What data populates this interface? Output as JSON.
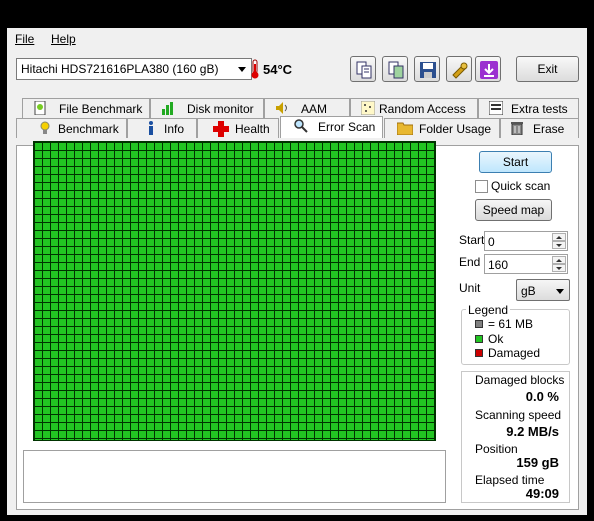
{
  "menu": {
    "file": "File",
    "help": "Help"
  },
  "toolbar": {
    "drive": "Hitachi HDS721616PLA380 (160 gB)",
    "temperature": "54°C",
    "exit_label": "Exit"
  },
  "tabs_top": [
    {
      "label": "File Benchmark"
    },
    {
      "label": "Disk monitor"
    },
    {
      "label": "AAM"
    },
    {
      "label": "Random Access"
    },
    {
      "label": "Extra tests"
    }
  ],
  "tabs_bottom": [
    {
      "label": "Benchmark"
    },
    {
      "label": "Info"
    },
    {
      "label": "Health"
    },
    {
      "label": "Error Scan"
    },
    {
      "label": "Folder Usage"
    },
    {
      "label": "Erase"
    }
  ],
  "scan": {
    "start_button": "Start",
    "quick_scan_label": "Quick scan",
    "quick_scan_checked": false,
    "speed_map_button": "Speed map",
    "start_label": "Start",
    "start_value": "0",
    "end_label": "End",
    "end_value": "160",
    "unit_label": "Unit",
    "unit_value": "gB"
  },
  "legend": {
    "title": "Legend",
    "block_size": "= 61 MB",
    "ok": "Ok",
    "damaged": "Damaged",
    "colors": {
      "block": "#808080",
      "ok": "#22c522",
      "damaged": "#cc0000"
    }
  },
  "stats": {
    "damaged_blocks_label": "Damaged blocks",
    "damaged_blocks_value": "0.0 %",
    "scanning_speed_label": "Scanning speed",
    "scanning_speed_value": "9.2 MB/s",
    "position_label": "Position",
    "position_value": "159 gB",
    "elapsed_label": "Elapsed time",
    "elapsed_value": "49:09"
  }
}
